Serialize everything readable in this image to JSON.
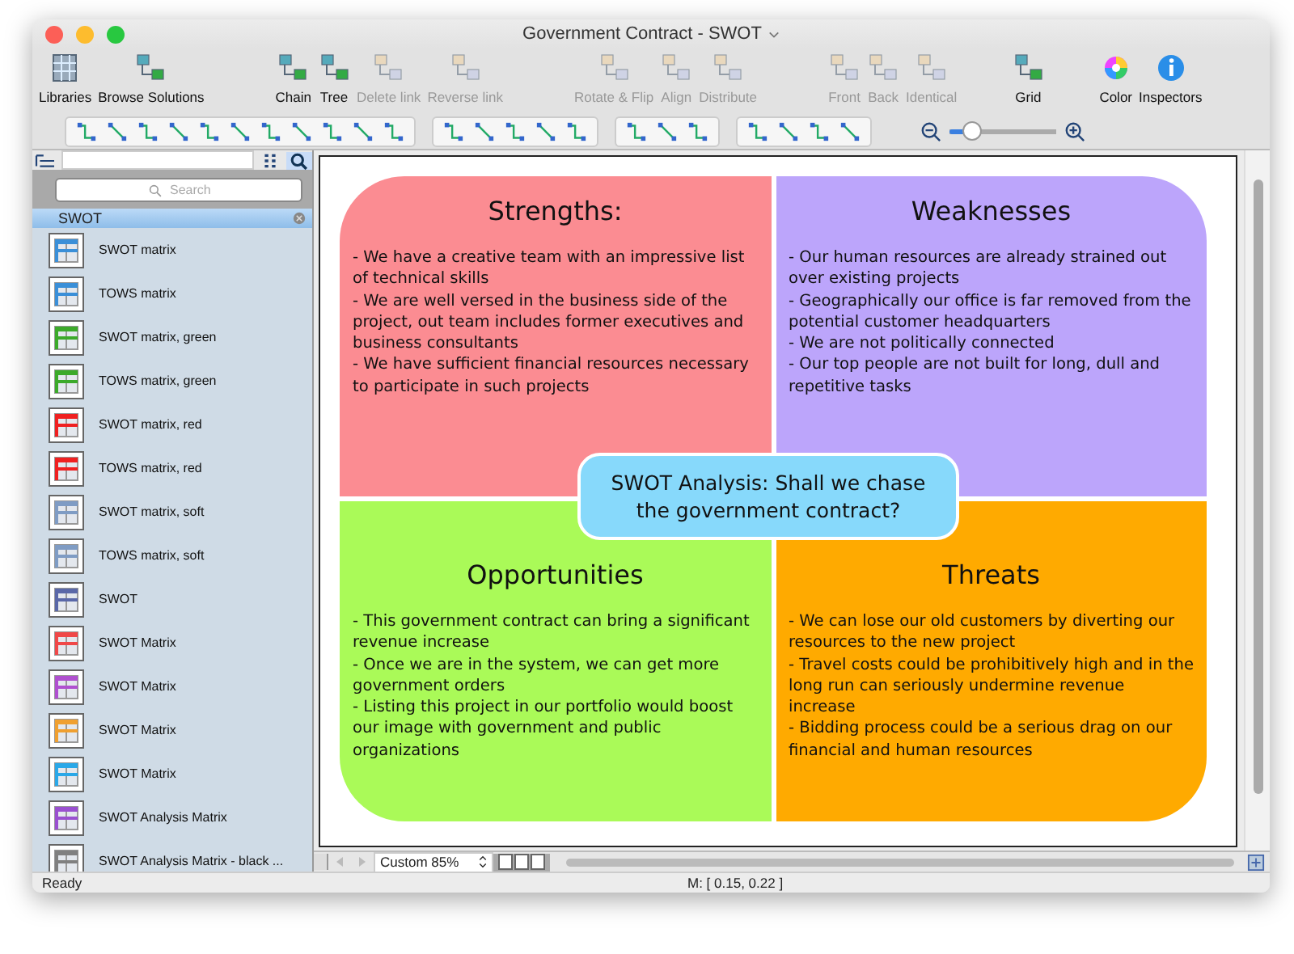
{
  "window": {
    "title": "Government Contract - SWOT"
  },
  "toolbar": [
    {
      "label": "Libraries",
      "disabled": false
    },
    {
      "label": "Browse Solutions",
      "disabled": false
    },
    {
      "label": "Chain",
      "disabled": false
    },
    {
      "label": "Tree",
      "disabled": false
    },
    {
      "label": "Delete link",
      "disabled": true
    },
    {
      "label": "Reverse link",
      "disabled": true
    },
    {
      "label": "Rotate & Flip",
      "disabled": true
    },
    {
      "label": "Align",
      "disabled": true
    },
    {
      "label": "Distribute",
      "disabled": true
    },
    {
      "label": "Front",
      "disabled": true
    },
    {
      "label": "Back",
      "disabled": true
    },
    {
      "label": "Identical",
      "disabled": true
    },
    {
      "label": "Grid",
      "disabled": false
    },
    {
      "label": "Color",
      "disabled": false
    },
    {
      "label": "Inspectors",
      "disabled": false
    }
  ],
  "zoom_slider": {
    "level": 0.2
  },
  "sidebar": {
    "search": {
      "placeholder": "Search"
    },
    "library": "SWOT",
    "items": [
      {
        "label": "SWOT matrix",
        "color": "#3a8fd8"
      },
      {
        "label": "TOWS matrix",
        "color": "#3a8fd8"
      },
      {
        "label": "SWOT matrix, green",
        "color": "#3caa2a"
      },
      {
        "label": "TOWS matrix, green",
        "color": "#3caa2a"
      },
      {
        "label": "SWOT matrix, red",
        "color": "#f02020"
      },
      {
        "label": "TOWS matrix, red",
        "color": "#f02020"
      },
      {
        "label": "SWOT matrix, soft",
        "color": "#7f9cc4"
      },
      {
        "label": "TOWS matrix, soft",
        "color": "#7f9cc4"
      },
      {
        "label": "SWOT",
        "color": "#5a68a8"
      },
      {
        "label": "SWOT Matrix",
        "color": "#f04848"
      },
      {
        "label": "SWOT Matrix",
        "color": "#b050d0"
      },
      {
        "label": "SWOT Matrix",
        "color": "#f0a030"
      },
      {
        "label": "SWOT Matrix",
        "color": "#2aa8e8"
      },
      {
        "label": "SWOT Analysis Matrix",
        "color": "#9a50d0"
      },
      {
        "label": "SWOT Analysis Matrix - black ...",
        "color": "#808080"
      }
    ]
  },
  "diagram": {
    "center": "SWOT Analysis: Shall we chase the government contract?",
    "quadrants": [
      {
        "title": "Strengths:",
        "color": "#fb8c92",
        "lines": [
          "- We have a creative team with an impressive list of technical skills",
          "- We are well versed in the business side of the project, out team includes former executives and business consultants",
          "- We have sufficient financial resources necessary to participate in such projects"
        ]
      },
      {
        "title": "Weaknesses",
        "color": "#bca5fb",
        "lines": [
          "- Our human resources are already strained out over existing projects",
          "- Geographically our office is far removed from the potential customer headquarters",
          "- We are not politically connected",
          "- Our top people are not built for long, dull and repetitive tasks"
        ]
      },
      {
        "title": "Opportunities",
        "color": "#aafa58",
        "lines": [
          "- This government contract can bring a significant revenue increase",
          "- Once we are in the system, we can get more government orders",
          "- Listing this project in our portfolio would boost our image with government and public organizations"
        ]
      },
      {
        "title": "Threats",
        "color": "#ffaa00",
        "lines": [
          "- We can lose our old customers by diverting our resources to the new project",
          "- Travel costs could be prohibitively high and in the long run can seriously undermine revenue increase",
          "- Bidding process could be a serious drag on our financial and human resources"
        ]
      }
    ]
  },
  "zoom_select": {
    "value": "Custom 85%"
  },
  "status_bar": {
    "left": "Ready",
    "coords": "M: [ 0.15, 0.22 ]"
  }
}
